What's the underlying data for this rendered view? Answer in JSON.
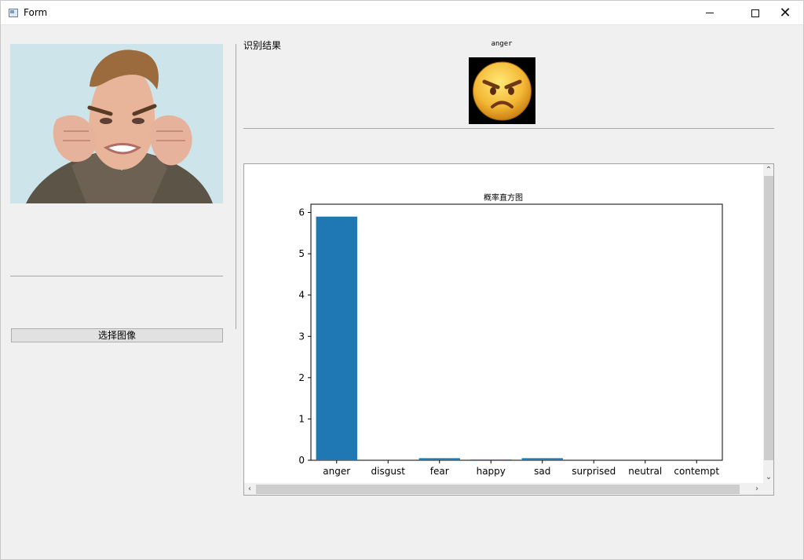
{
  "window": {
    "title": "Form",
    "controls": {
      "minimize": "—",
      "maximize": "□",
      "close": "✕"
    }
  },
  "left_panel": {
    "select_button_label": "选择图像"
  },
  "result": {
    "label": "识别结果",
    "emotion": "anger"
  },
  "colors": {
    "bar": "#1f77b4",
    "window_bg": "#f0f0f0"
  },
  "icons": {
    "app": "form-window-icon",
    "emoji": "angry-face-emoji-icon",
    "scroll_up": "scroll-up-icon",
    "scroll_down": "scroll-down-icon",
    "scroll_left": "scroll-left-icon",
    "scroll_right": "scroll-right-icon"
  },
  "chart_data": {
    "type": "bar",
    "title": "概率直方图",
    "xlabel": "",
    "ylabel": "",
    "categories": [
      "anger",
      "disgust",
      "fear",
      "happy",
      "sad",
      "surprised",
      "neutral",
      "contempt"
    ],
    "values": [
      5.9,
      0.0,
      0.05,
      0.02,
      0.05,
      0.0,
      0.0,
      0.0
    ],
    "yticks": [
      0,
      1,
      2,
      3,
      4,
      5,
      6
    ],
    "ylim": [
      0,
      6.2
    ],
    "grid": false
  }
}
